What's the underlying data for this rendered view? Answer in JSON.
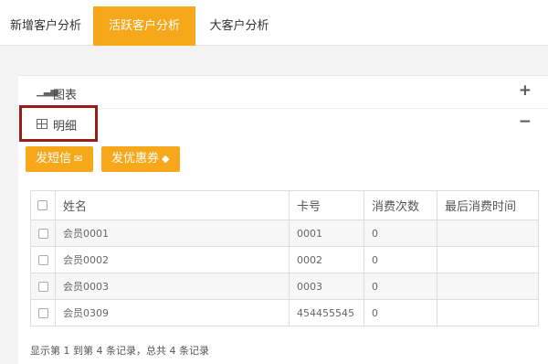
{
  "tabs": [
    {
      "label": "新增客户分析",
      "active": false
    },
    {
      "label": "活跃客户分析",
      "active": true
    },
    {
      "label": "大客户分析",
      "active": false
    }
  ],
  "sections": {
    "chart": {
      "label": "图表",
      "icon": "bar-chart-icon",
      "toggle": "+"
    },
    "detail": {
      "label": "明细",
      "icon": "table-icon",
      "toggle": "−"
    }
  },
  "buttons": {
    "sms": {
      "label": "发短信",
      "icon": "envelope-icon"
    },
    "coupon": {
      "label": "发优惠券",
      "icon": "tag-icon"
    }
  },
  "table": {
    "headers": [
      "姓名",
      "卡号",
      "消费次数",
      "最后消费时间"
    ],
    "rows": [
      {
        "name": "会员0001",
        "card": "0001",
        "count": "0",
        "last": ""
      },
      {
        "name": "会员0002",
        "card": "0002",
        "count": "0",
        "last": ""
      },
      {
        "name": "会员0003",
        "card": "0003",
        "count": "0",
        "last": ""
      },
      {
        "name": "会员0309",
        "card": "454455545",
        "count": "0",
        "last": ""
      }
    ]
  },
  "footer": "显示第 1 到第 4 条记录，总共 4 条记录",
  "colors": {
    "accent": "#f6a81a",
    "highlight_border": "#9b1b1b"
  }
}
